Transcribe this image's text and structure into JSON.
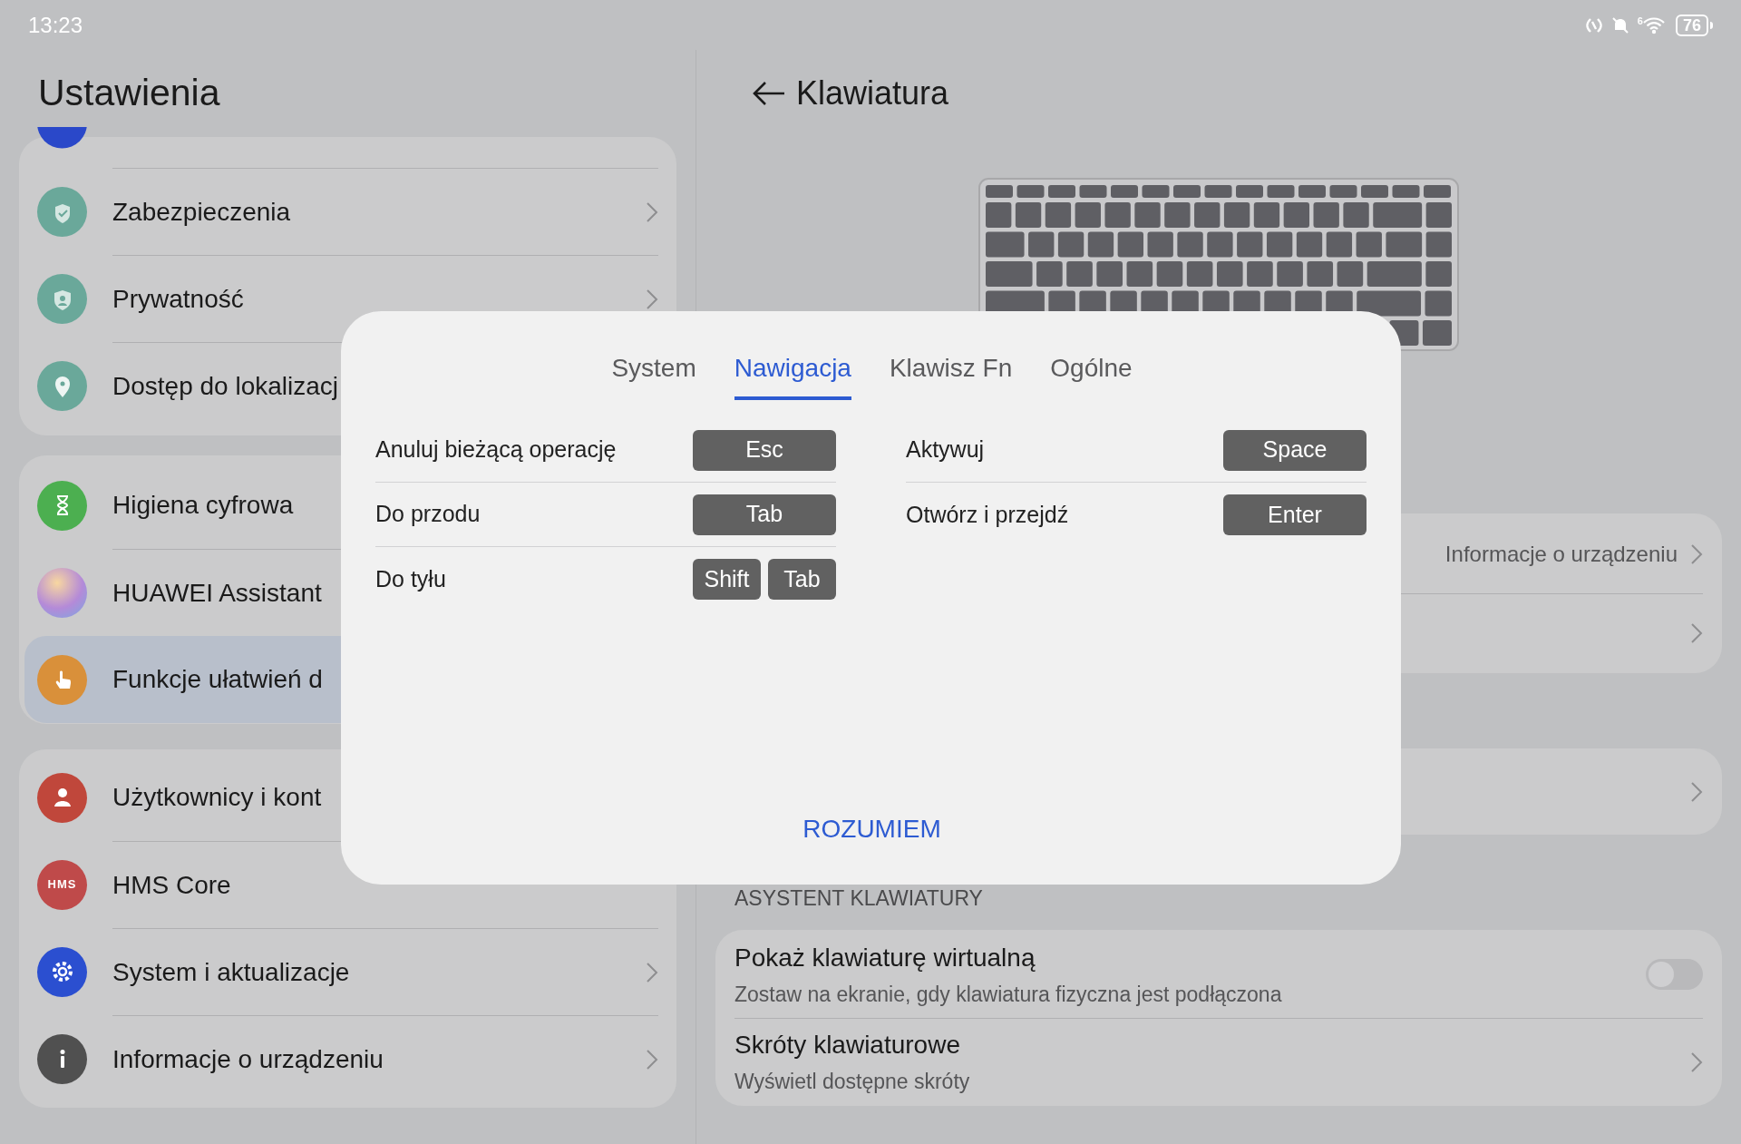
{
  "status_bar": {
    "time": "13:23",
    "wifi_band": "6",
    "battery": "76"
  },
  "sidebar": {
    "title": "Ustawienia",
    "groups": [
      {
        "partial_top": true,
        "items": [
          {
            "label": "Zabezpieczenia",
            "color": "#6aa89a",
            "selected": false
          },
          {
            "label": "Prywatność",
            "color": "#6aa89a",
            "selected": false
          },
          {
            "label": "Dostęp do lokalizacj",
            "color": "#6aa89a",
            "selected": false
          }
        ]
      },
      {
        "items": [
          {
            "label": "Higiena cyfrowa",
            "color": "#4caf50",
            "selected": false
          },
          {
            "label": "HUAWEI Assistant",
            "color": "#b48ad8",
            "selected": false
          },
          {
            "label": "Funkcje ułatwień d",
            "color": "#d9903a",
            "selected": true
          }
        ]
      },
      {
        "items": [
          {
            "label": "Użytkownicy i kont",
            "color": "#c0473b",
            "selected": false
          },
          {
            "label": "HMS Core",
            "color": "#bf4a4a",
            "icon_text": "HMS",
            "selected": false
          },
          {
            "label": "System i aktualizacje",
            "color": "#2b4fd0",
            "selected": false
          },
          {
            "label": "Informacje o urządzeniu",
            "color": "#505050",
            "selected": false
          }
        ]
      }
    ]
  },
  "detail": {
    "title": "Klawiatura",
    "cards": [
      {
        "rows": [
          {
            "kind": "link",
            "value": "Informacje o urządzeniu"
          },
          {
            "kind": "link"
          }
        ]
      },
      {
        "rows": [
          {
            "kind": "link"
          }
        ]
      },
      {
        "header": "ASYSTENT KLAWIATURY",
        "rows": [
          {
            "kind": "toggle",
            "title": "Pokaż klawiaturę wirtualną",
            "subtitle": "Zostaw na ekranie, gdy klawiatura fizyczna jest podłączona",
            "on": false
          },
          {
            "kind": "link",
            "title": "Skróty klawiaturowe",
            "subtitle": "Wyświetl dostępne skróty"
          }
        ]
      }
    ]
  },
  "dialog": {
    "tabs": [
      {
        "label": "System",
        "selected": false
      },
      {
        "label": "Nawigacja",
        "selected": true
      },
      {
        "label": "Klawisz Fn",
        "selected": false
      },
      {
        "label": "Ogólne",
        "selected": false
      }
    ],
    "columns": [
      [
        {
          "label": "Anuluj bieżącą operację",
          "keys": [
            "Esc"
          ]
        },
        {
          "label": "Do przodu",
          "keys": [
            "Tab"
          ]
        },
        {
          "label": "Do tyłu",
          "keys": [
            "Shift",
            "Tab"
          ]
        }
      ],
      [
        {
          "label": "Aktywuj",
          "keys": [
            "Space"
          ]
        },
        {
          "label": "Otwórz i przejdź",
          "keys": [
            "Enter"
          ]
        }
      ]
    ],
    "button": "ROZUMIEM"
  }
}
